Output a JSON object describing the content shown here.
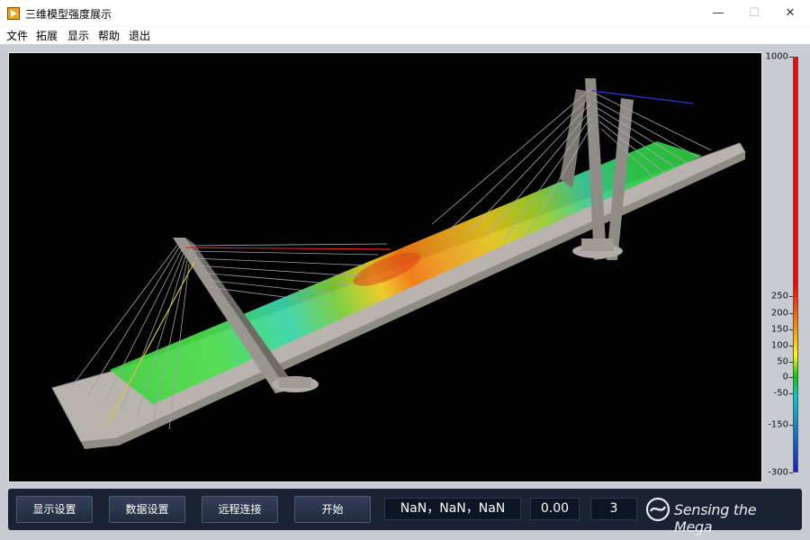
{
  "window": {
    "title": "三维模型强度展示",
    "min_glyph": "—",
    "max_glyph": "☐",
    "close_glyph": "✕"
  },
  "menu": [
    "文件",
    "拓展",
    "显示",
    "帮助",
    "退出"
  ],
  "legend": {
    "labels": [
      "1000",
      "250",
      "200",
      "150",
      "100",
      "50",
      "0",
      "-50",
      "-150",
      "-300"
    ],
    "colors": {
      "max": "#ff0000",
      "high": "#ff8c00",
      "mid_high": "#ffff00",
      "mid": "#00cc00",
      "low": "#00cccc",
      "min": "#1a1acc"
    }
  },
  "toolbar": {
    "buttons": [
      "显示设置",
      "数据设置",
      "远程连接",
      "开始"
    ],
    "coordinates": "NaN，NaN，NaN",
    "value": "0.00",
    "count": "3",
    "brand": "Sensing the Mega"
  },
  "icons": {
    "app": "labview-run-icon",
    "brand": "brand-logo-icon"
  }
}
